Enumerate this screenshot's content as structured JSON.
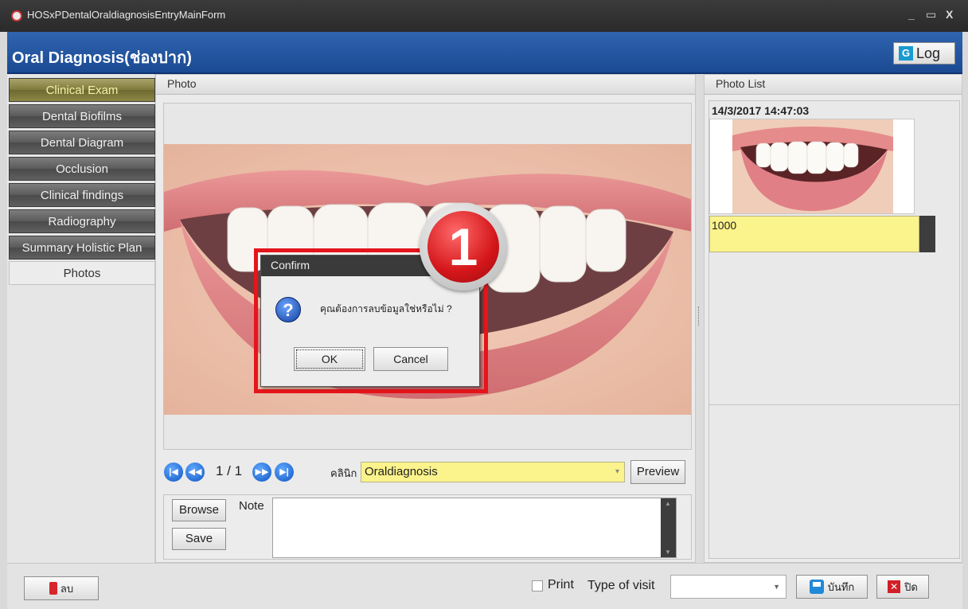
{
  "window": {
    "title": "HOSxPDentalOraldiagnosisEntryMainForm",
    "minimize": "_",
    "maximize": "▭",
    "close": "X"
  },
  "header": {
    "title": "Oral Diagnosis(ช่องปาก)",
    "log_button": "Log",
    "log_icon": "G"
  },
  "sidebar": {
    "items": [
      {
        "label": "Clinical Exam"
      },
      {
        "label": "Dental Biofilms"
      },
      {
        "label": "Dental Diagram"
      },
      {
        "label": "Occlusion"
      },
      {
        "label": "Clinical findings"
      },
      {
        "label": "Radiography"
      },
      {
        "label": "Summary Holistic Plan"
      },
      {
        "label": "Photos"
      }
    ],
    "active": "Clinical Exam",
    "selected_tab": "Photos"
  },
  "photo_panel": {
    "header": "Photo",
    "page_indicator": "1 / 1",
    "clinic_label": "คลินิก",
    "clinic_value": "Oraldiagnosis",
    "preview_button": "Preview",
    "browse_button": "Browse",
    "save_button": "Save",
    "note_label": "Note",
    "note_value": ""
  },
  "dialog": {
    "title": "Confirm",
    "message": "คุณต้องการลบข้อมูลใช่หรือไม่ ?",
    "ok": "OK",
    "cancel": "Cancel",
    "icon": "?",
    "badge_number": "1",
    "highlight_color": "#e4151b"
  },
  "photo_list": {
    "header": "Photo List",
    "entries": [
      {
        "datetime": "14/3/2017 14:47:03",
        "value": "1000"
      }
    ]
  },
  "bottom_bar": {
    "delete_button": "ลบ",
    "print_label": "Print",
    "print_checked": false,
    "type_of_visit_label": "Type of visit",
    "type_of_visit_value": "",
    "save_button": "บันทึก",
    "close_button": "ปิด"
  },
  "colors": {
    "header_blue": "#2f64b0",
    "input_yellow": "#fbf38b",
    "nav_dark": "#5a5a5a"
  }
}
